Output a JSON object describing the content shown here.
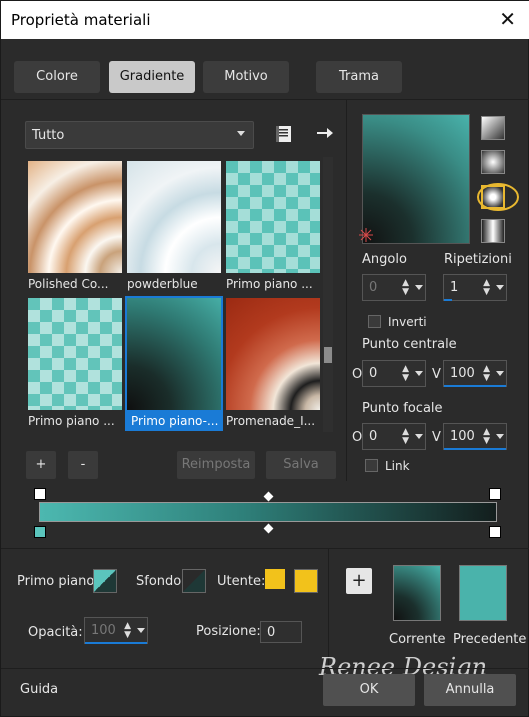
{
  "window": {
    "title": "Proprietà materiali",
    "close_glyph": "✕"
  },
  "tabs": [
    "Colore",
    "Gradiente",
    "Motivo",
    "Trama"
  ],
  "active_tab": "Gradiente",
  "category": {
    "selected": "Tutto"
  },
  "thumbnails": [
    {
      "label": "Polished Co..."
    },
    {
      "label": "powderblue"
    },
    {
      "label": "Primo piano ..."
    },
    {
      "label": "Primo piano ..."
    },
    {
      "label": "Primo piano-...",
      "selected": true
    },
    {
      "label": "Promenade_I..."
    }
  ],
  "buttons": {
    "add": "+",
    "remove": "-",
    "reset": "Reimposta",
    "save": "Salva",
    "help": "Guida",
    "ok": "OK",
    "cancel": "Annulla"
  },
  "angle": {
    "label": "Angolo",
    "value": "0"
  },
  "repeats": {
    "label": "Ripetizioni",
    "value": "1"
  },
  "invert": {
    "label": "Inverti",
    "checked": false
  },
  "center_point": {
    "label": "Punto centrale",
    "o_label": "O",
    "o_value": "0",
    "v_label": "V",
    "v_value": "100"
  },
  "focal_point": {
    "label": "Punto focale",
    "o_label": "O",
    "o_value": "0",
    "v_label": "V",
    "v_value": "100"
  },
  "link": {
    "label": "Link",
    "checked": false
  },
  "foreground": {
    "label": "Primo piano:"
  },
  "background": {
    "label": "Sfondo:"
  },
  "user": {
    "label": "Utente:"
  },
  "opacity": {
    "label": "Opacità:",
    "value": "100"
  },
  "position": {
    "label": "Posizione:",
    "value": "0"
  },
  "current_label": "Corrente",
  "previous_label": "Precedente",
  "colors": {
    "accent": "#1a7bd6",
    "gradient_start": "#4cb8b0",
    "gradient_end": "#131e1d",
    "user_color": "#f2c21b",
    "previous": "#4ab3ab"
  },
  "watermark": "Renee Design"
}
